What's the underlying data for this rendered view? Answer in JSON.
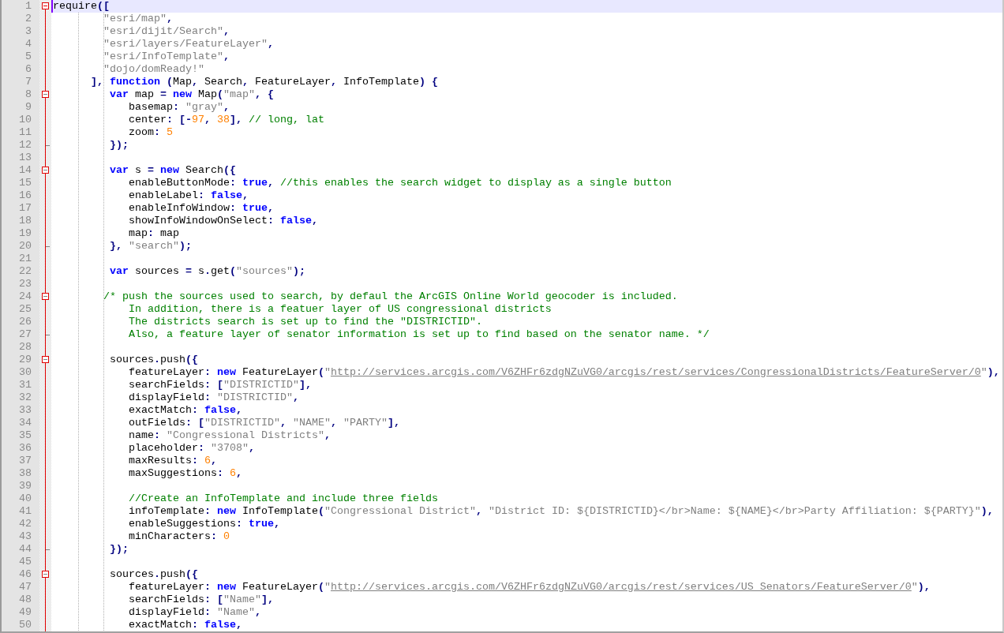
{
  "editor": {
    "lines": [
      {
        "number": "1",
        "kind": "fold-start",
        "current": true,
        "tokens": [
          {
            "kind": "plain",
            "text": "require"
          },
          {
            "kind": "op",
            "text": "(["
          }
        ]
      },
      {
        "number": "2",
        "kind": "code",
        "current": false,
        "tokens": [
          {
            "kind": "string",
            "text": "        \"esri/map\""
          },
          {
            "kind": "op",
            "text": ","
          }
        ]
      },
      {
        "number": "3",
        "kind": "code",
        "current": false,
        "tokens": [
          {
            "kind": "string",
            "text": "        \"esri/dijit/Search\""
          },
          {
            "kind": "op",
            "text": ","
          }
        ]
      },
      {
        "number": "4",
        "kind": "code",
        "current": false,
        "tokens": [
          {
            "kind": "string",
            "text": "        \"esri/layers/FeatureLayer\""
          },
          {
            "kind": "op",
            "text": ","
          }
        ]
      },
      {
        "number": "5",
        "kind": "code",
        "current": false,
        "tokens": [
          {
            "kind": "string",
            "text": "        \"esri/InfoTemplate\""
          },
          {
            "kind": "op",
            "text": ","
          }
        ]
      },
      {
        "number": "6",
        "kind": "code",
        "current": false,
        "tokens": [
          {
            "kind": "string",
            "text": "        \"dojo/domReady!\""
          }
        ]
      },
      {
        "number": "7",
        "kind": "code",
        "current": false,
        "tokens": [
          {
            "kind": "op",
            "text": "      ], "
          },
          {
            "kind": "keyword",
            "text": "function"
          },
          {
            "kind": "op",
            "text": " ("
          },
          {
            "kind": "plain",
            "text": "Map"
          },
          {
            "kind": "op",
            "text": ", "
          },
          {
            "kind": "plain",
            "text": "Search"
          },
          {
            "kind": "op",
            "text": ", "
          },
          {
            "kind": "plain",
            "text": "FeatureLayer"
          },
          {
            "kind": "op",
            "text": ", "
          },
          {
            "kind": "plain",
            "text": "InfoTemplate"
          },
          {
            "kind": "op",
            "text": ") {"
          }
        ]
      },
      {
        "number": "8",
        "kind": "fold-start",
        "current": false,
        "tokens": [
          {
            "kind": "keyword",
            "text": "         var"
          },
          {
            "kind": "plain",
            "text": " map "
          },
          {
            "kind": "op",
            "text": "= "
          },
          {
            "kind": "keyword",
            "text": "new"
          },
          {
            "kind": "plain",
            "text": " Map"
          },
          {
            "kind": "op",
            "text": "("
          },
          {
            "kind": "string",
            "text": "\"map\""
          },
          {
            "kind": "op",
            "text": ", {"
          }
        ]
      },
      {
        "number": "9",
        "kind": "code",
        "current": false,
        "tokens": [
          {
            "kind": "plain",
            "text": "            basemap"
          },
          {
            "kind": "op",
            "text": ": "
          },
          {
            "kind": "string",
            "text": "\"gray\""
          },
          {
            "kind": "op",
            "text": ","
          }
        ]
      },
      {
        "number": "10",
        "kind": "code",
        "current": false,
        "tokens": [
          {
            "kind": "plain",
            "text": "            center"
          },
          {
            "kind": "op",
            "text": ": [-"
          },
          {
            "kind": "number",
            "text": "97"
          },
          {
            "kind": "op",
            "text": ", "
          },
          {
            "kind": "number",
            "text": "38"
          },
          {
            "kind": "op",
            "text": "], "
          },
          {
            "kind": "comment",
            "text": "// long, lat"
          }
        ]
      },
      {
        "number": "11",
        "kind": "code",
        "current": false,
        "tokens": [
          {
            "kind": "plain",
            "text": "            zoom"
          },
          {
            "kind": "op",
            "text": ": "
          },
          {
            "kind": "number",
            "text": "5"
          }
        ]
      },
      {
        "number": "12",
        "kind": "fold-end",
        "current": false,
        "tokens": [
          {
            "kind": "op",
            "text": "         });"
          }
        ]
      },
      {
        "number": "13",
        "kind": "code",
        "current": false
      },
      {
        "number": "14",
        "kind": "fold-start",
        "current": false,
        "tokens": [
          {
            "kind": "keyword",
            "text": "         var"
          },
          {
            "kind": "plain",
            "text": " s "
          },
          {
            "kind": "op",
            "text": "= "
          },
          {
            "kind": "keyword",
            "text": "new"
          },
          {
            "kind": "plain",
            "text": " Search"
          },
          {
            "kind": "op",
            "text": "({"
          }
        ]
      },
      {
        "number": "15",
        "kind": "code",
        "current": false,
        "tokens": [
          {
            "kind": "plain",
            "text": "            enableButtonMode"
          },
          {
            "kind": "op",
            "text": ": "
          },
          {
            "kind": "keyword",
            "text": "true"
          },
          {
            "kind": "op",
            "text": ", "
          },
          {
            "kind": "comment",
            "text": "//this enables the search widget to display as a single button"
          }
        ]
      },
      {
        "number": "16",
        "kind": "code",
        "current": false,
        "tokens": [
          {
            "kind": "plain",
            "text": "            enableLabel"
          },
          {
            "kind": "op",
            "text": ": "
          },
          {
            "kind": "keyword",
            "text": "false"
          },
          {
            "kind": "op",
            "text": ","
          }
        ]
      },
      {
        "number": "17",
        "kind": "code",
        "current": false,
        "tokens": [
          {
            "kind": "plain",
            "text": "            enableInfoWindow"
          },
          {
            "kind": "op",
            "text": ": "
          },
          {
            "kind": "keyword",
            "text": "true"
          },
          {
            "kind": "op",
            "text": ","
          }
        ]
      },
      {
        "number": "18",
        "kind": "code",
        "current": false,
        "tokens": [
          {
            "kind": "plain",
            "text": "            showInfoWindowOnSelect"
          },
          {
            "kind": "op",
            "text": ": "
          },
          {
            "kind": "keyword",
            "text": "false"
          },
          {
            "kind": "op",
            "text": ","
          }
        ]
      },
      {
        "number": "19",
        "kind": "code",
        "current": false,
        "tokens": [
          {
            "kind": "plain",
            "text": "            map"
          },
          {
            "kind": "op",
            "text": ": "
          },
          {
            "kind": "plain",
            "text": "map"
          }
        ]
      },
      {
        "number": "20",
        "kind": "fold-end",
        "current": false,
        "tokens": [
          {
            "kind": "op",
            "text": "         }, "
          },
          {
            "kind": "string",
            "text": "\"search\""
          },
          {
            "kind": "op",
            "text": ");"
          }
        ]
      },
      {
        "number": "21",
        "kind": "code",
        "current": false
      },
      {
        "number": "22",
        "kind": "code",
        "current": false,
        "tokens": [
          {
            "kind": "keyword",
            "text": "         var"
          },
          {
            "kind": "plain",
            "text": " sources "
          },
          {
            "kind": "op",
            "text": "= "
          },
          {
            "kind": "plain",
            "text": "s"
          },
          {
            "kind": "op",
            "text": "."
          },
          {
            "kind": "plain",
            "text": "get"
          },
          {
            "kind": "op",
            "text": "("
          },
          {
            "kind": "string",
            "text": "\"sources\""
          },
          {
            "kind": "op",
            "text": ");"
          }
        ]
      },
      {
        "number": "23",
        "kind": "code",
        "current": false
      },
      {
        "number": "24",
        "kind": "fold-start",
        "current": false,
        "tokens": [
          {
            "kind": "comment",
            "text": "        /* push the sources used to search, by defaul the ArcGIS Online World geocoder is included."
          }
        ]
      },
      {
        "number": "25",
        "kind": "code",
        "current": false,
        "tokens": [
          {
            "kind": "comment",
            "text": "            In addition, there is a featuer layer of US congressional districts"
          }
        ]
      },
      {
        "number": "26",
        "kind": "code",
        "current": false,
        "tokens": [
          {
            "kind": "comment",
            "text": "            The districts search is set up to find the \"DISTRICTID\"."
          }
        ]
      },
      {
        "number": "27",
        "kind": "fold-end",
        "current": false,
        "tokens": [
          {
            "kind": "comment",
            "text": "            Also, a feature layer of senator information is set up to find based on the senator name. */"
          }
        ]
      },
      {
        "number": "28",
        "kind": "code",
        "current": false
      },
      {
        "number": "29",
        "kind": "fold-start",
        "current": false,
        "tokens": [
          {
            "kind": "plain",
            "text": "         sources"
          },
          {
            "kind": "op",
            "text": "."
          },
          {
            "kind": "plain",
            "text": "push"
          },
          {
            "kind": "op",
            "text": "({"
          }
        ]
      },
      {
        "number": "30",
        "kind": "code",
        "current": false,
        "tokens": [
          {
            "kind": "plain",
            "text": "            featureLayer"
          },
          {
            "kind": "op",
            "text": ": "
          },
          {
            "kind": "keyword",
            "text": "new"
          },
          {
            "kind": "plain",
            "text": " FeatureLayer"
          },
          {
            "kind": "op",
            "text": "("
          },
          {
            "kind": "string",
            "text": "\""
          },
          {
            "kind": "url",
            "text": "http://services.arcgis.com/V6ZHFr6zdgNZuVG0/arcgis/rest/services/CongressionalDistricts/FeatureServer/0"
          },
          {
            "kind": "string",
            "text": "\""
          },
          {
            "kind": "op",
            "text": "),"
          }
        ]
      },
      {
        "number": "31",
        "kind": "code",
        "current": false,
        "tokens": [
          {
            "kind": "plain",
            "text": "            searchFields"
          },
          {
            "kind": "op",
            "text": ": ["
          },
          {
            "kind": "string",
            "text": "\"DISTRICTID\""
          },
          {
            "kind": "op",
            "text": "],"
          }
        ]
      },
      {
        "number": "32",
        "kind": "code",
        "current": false,
        "tokens": [
          {
            "kind": "plain",
            "text": "            displayField"
          },
          {
            "kind": "op",
            "text": ": "
          },
          {
            "kind": "string",
            "text": "\"DISTRICTID\""
          },
          {
            "kind": "op",
            "text": ","
          }
        ]
      },
      {
        "number": "33",
        "kind": "code",
        "current": false,
        "tokens": [
          {
            "kind": "plain",
            "text": "            exactMatch"
          },
          {
            "kind": "op",
            "text": ": "
          },
          {
            "kind": "keyword",
            "text": "false"
          },
          {
            "kind": "op",
            "text": ","
          }
        ]
      },
      {
        "number": "34",
        "kind": "code",
        "current": false,
        "tokens": [
          {
            "kind": "plain",
            "text": "            outFields"
          },
          {
            "kind": "op",
            "text": ": ["
          },
          {
            "kind": "string",
            "text": "\"DISTRICTID\""
          },
          {
            "kind": "op",
            "text": ", "
          },
          {
            "kind": "string",
            "text": "\"NAME\""
          },
          {
            "kind": "op",
            "text": ", "
          },
          {
            "kind": "string",
            "text": "\"PARTY\""
          },
          {
            "kind": "op",
            "text": "],"
          }
        ]
      },
      {
        "number": "35",
        "kind": "code",
        "current": false,
        "tokens": [
          {
            "kind": "plain",
            "text": "            name"
          },
          {
            "kind": "op",
            "text": ": "
          },
          {
            "kind": "string",
            "text": "\"Congressional Districts\""
          },
          {
            "kind": "op",
            "text": ","
          }
        ]
      },
      {
        "number": "36",
        "kind": "code",
        "current": false,
        "tokens": [
          {
            "kind": "plain",
            "text": "            placeholder"
          },
          {
            "kind": "op",
            "text": ": "
          },
          {
            "kind": "string",
            "text": "\"3708\""
          },
          {
            "kind": "op",
            "text": ","
          }
        ]
      },
      {
        "number": "37",
        "kind": "code",
        "current": false,
        "tokens": [
          {
            "kind": "plain",
            "text": "            maxResults"
          },
          {
            "kind": "op",
            "text": ": "
          },
          {
            "kind": "number",
            "text": "6"
          },
          {
            "kind": "op",
            "text": ","
          }
        ]
      },
      {
        "number": "38",
        "kind": "code",
        "current": false,
        "tokens": [
          {
            "kind": "plain",
            "text": "            maxSuggestions"
          },
          {
            "kind": "op",
            "text": ": "
          },
          {
            "kind": "number",
            "text": "6"
          },
          {
            "kind": "op",
            "text": ","
          }
        ]
      },
      {
        "number": "39",
        "kind": "code",
        "current": false
      },
      {
        "number": "40",
        "kind": "code",
        "current": false,
        "tokens": [
          {
            "kind": "comment",
            "text": "            //Create an InfoTemplate and include three fields"
          }
        ]
      },
      {
        "number": "41",
        "kind": "code",
        "current": false,
        "tokens": [
          {
            "kind": "plain",
            "text": "            infoTemplate"
          },
          {
            "kind": "op",
            "text": ": "
          },
          {
            "kind": "keyword",
            "text": "new"
          },
          {
            "kind": "plain",
            "text": " InfoTemplate"
          },
          {
            "kind": "op",
            "text": "("
          },
          {
            "kind": "string",
            "text": "\"Congressional District\""
          },
          {
            "kind": "op",
            "text": ", "
          },
          {
            "kind": "string",
            "text": "\"District ID: ${DISTRICTID}</br>Name: ${NAME}</br>Party Affiliation: ${PARTY}\""
          },
          {
            "kind": "op",
            "text": "),"
          }
        ]
      },
      {
        "number": "42",
        "kind": "code",
        "current": false,
        "tokens": [
          {
            "kind": "plain",
            "text": "            enableSuggestions"
          },
          {
            "kind": "op",
            "text": ": "
          },
          {
            "kind": "keyword",
            "text": "true"
          },
          {
            "kind": "op",
            "text": ","
          }
        ]
      },
      {
        "number": "43",
        "kind": "code",
        "current": false,
        "tokens": [
          {
            "kind": "plain",
            "text": "            minCharacters"
          },
          {
            "kind": "op",
            "text": ": "
          },
          {
            "kind": "number",
            "text": "0"
          }
        ]
      },
      {
        "number": "44",
        "kind": "fold-end",
        "current": false,
        "tokens": [
          {
            "kind": "op",
            "text": "         });"
          }
        ]
      },
      {
        "number": "45",
        "kind": "code",
        "current": false
      },
      {
        "number": "46",
        "kind": "fold-start",
        "current": false,
        "tokens": [
          {
            "kind": "plain",
            "text": "         sources"
          },
          {
            "kind": "op",
            "text": "."
          },
          {
            "kind": "plain",
            "text": "push"
          },
          {
            "kind": "op",
            "text": "({"
          }
        ]
      },
      {
        "number": "47",
        "kind": "code",
        "current": false,
        "tokens": [
          {
            "kind": "plain",
            "text": "            featureLayer"
          },
          {
            "kind": "op",
            "text": ": "
          },
          {
            "kind": "keyword",
            "text": "new"
          },
          {
            "kind": "plain",
            "text": " FeatureLayer"
          },
          {
            "kind": "op",
            "text": "("
          },
          {
            "kind": "string",
            "text": "\""
          },
          {
            "kind": "url",
            "text": "http://services.arcgis.com/V6ZHFr6zdgNZuVG0/arcgis/rest/services/US_Senators/FeatureServer/0"
          },
          {
            "kind": "string",
            "text": "\""
          },
          {
            "kind": "op",
            "text": "),"
          }
        ]
      },
      {
        "number": "48",
        "kind": "code",
        "current": false,
        "tokens": [
          {
            "kind": "plain",
            "text": "            searchFields"
          },
          {
            "kind": "op",
            "text": ": ["
          },
          {
            "kind": "string",
            "text": "\"Name\""
          },
          {
            "kind": "op",
            "text": "],"
          }
        ]
      },
      {
        "number": "49",
        "kind": "code",
        "current": false,
        "tokens": [
          {
            "kind": "plain",
            "text": "            displayField"
          },
          {
            "kind": "op",
            "text": ": "
          },
          {
            "kind": "string",
            "text": "\"Name\""
          },
          {
            "kind": "op",
            "text": ","
          }
        ]
      },
      {
        "number": "50",
        "kind": "code",
        "current": false,
        "tokens": [
          {
            "kind": "plain",
            "text": "            exactMatch"
          },
          {
            "kind": "op",
            "text": ": "
          },
          {
            "kind": "keyword",
            "text": "false"
          },
          {
            "kind": "op",
            "text": ","
          }
        ]
      }
    ]
  }
}
